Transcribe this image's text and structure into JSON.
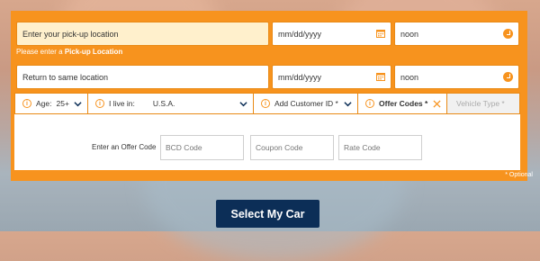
{
  "pickup": {
    "location_placeholder": "Enter your pick-up location",
    "date": "mm/dd/yyyy",
    "time": "noon"
  },
  "validation": {
    "message_prefix": "Please enter a ",
    "message_strong": "Pick-up Location"
  },
  "return": {
    "location_label": "Return to same location",
    "date": "mm/dd/yyyy",
    "time": "noon"
  },
  "options": {
    "age_label": "Age:",
    "age_value": "25+",
    "country_label": "I live in:",
    "country_value": "U.S.A.",
    "customer_id_label": "Add Customer ID *",
    "offer_codes_label": "Offer Codes *",
    "vehicle_type_label": "Vehicle Type *"
  },
  "offer": {
    "label": "Enter an Offer Code",
    "bcd_placeholder": "BCD Code",
    "coupon_placeholder": "Coupon Code",
    "rate_placeholder": "Rate Code",
    "optional_note": "* Optional"
  },
  "submit_label": "Select My Car",
  "colors": {
    "accent": "#f7931e",
    "button": "#0c2e57",
    "highlight_field": "#fff0cc"
  }
}
